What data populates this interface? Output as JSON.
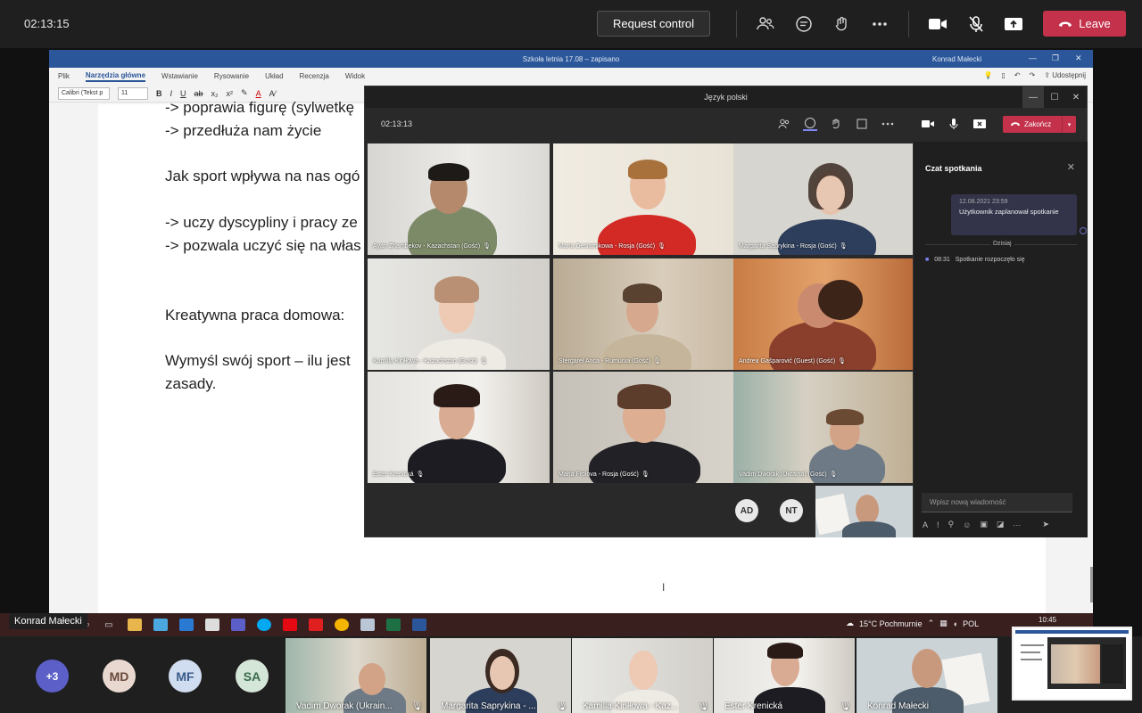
{
  "topbar": {
    "timer": "02:13:15",
    "request_control": "Request control",
    "leave": "Leave",
    "icons": [
      "people-icon",
      "chat-icon",
      "reactions-icon",
      "more-icon",
      "camera-icon",
      "mic-off-icon",
      "share-icon"
    ]
  },
  "word": {
    "title": "Szkoła letnia 17.08 – zapisano",
    "user": "Konrad Małecki",
    "tabs": [
      "Plik",
      "Narzędzia główne",
      "Wstawianie",
      "Rysowanie",
      "Układ",
      "Recenzja",
      "Widok"
    ],
    "share_label": "Udostępnij",
    "font_name": "Calibri (Tekst p",
    "font_size": "11",
    "lines": [
      "-> poprawia figurę (sylwetkę",
      "-> przedłuża nam życie",
      "Jak sport wpływa na nas ogó",
      "-> uczy dyscypliny i pracy ze",
      "-> pozwala uczyć się na włas",
      "Kreatywna praca domowa:",
      "Wymyśl swój sport – ilu jest",
      "zasady."
    ]
  },
  "taskbar": {
    "weather": "15°C  Pochmurnie",
    "lang": "POL",
    "time": "10:45"
  },
  "presenter": "Konrad Małecki",
  "inner": {
    "title": "Język polski",
    "timer": "02:13:13",
    "end_label": "Zakończ",
    "participants": [
      "Ayan Zhambekov - Kazachstan (Gość)",
      "Maria Desiatnikowa - Rosja (Gość)",
      "Margarita Saprykina - Rosja (Gość)",
      "Kamilla Kiriłłowa - Kazachstan (Gość)",
      "Stergarel Anca - Rumunia (Gość)",
      "Andrea Gašparović (Guest) (Gość)",
      "Ester Krenická",
      "Maria Frolova - Rosja (Gość)",
      "Vadim Dworak (Ukraina) (Gość)"
    ],
    "avatars": [
      "AD",
      "NT"
    ],
    "chat": {
      "title": "Czat spotkania",
      "timestamp": "12.08.2021 23:59",
      "message": "Użytkownik zaplanował spotkanie",
      "day": "Dzisiaj",
      "event_time": "08:31",
      "event_text": "Spotkanie rozpoczęło się",
      "placeholder": "Wpisz nową wiadomość"
    }
  },
  "strip": {
    "more": "+3",
    "avatars": [
      {
        "initials": "MD",
        "color": "#e8d8d0",
        "text": "#6b4a3a"
      },
      {
        "initials": "MF",
        "color": "#d0dcef",
        "text": "#3a5a8a"
      },
      {
        "initials": "SA",
        "color": "#d3e6d8",
        "text": "#3a6a4a"
      }
    ],
    "tiles": [
      "Vadim Dworak (Ukrain...",
      "Margarita Saprykina - ...",
      "Kamilla Kiriłłowa - Kaz...",
      "Ester Krenická",
      "Konrad Małecki"
    ]
  }
}
